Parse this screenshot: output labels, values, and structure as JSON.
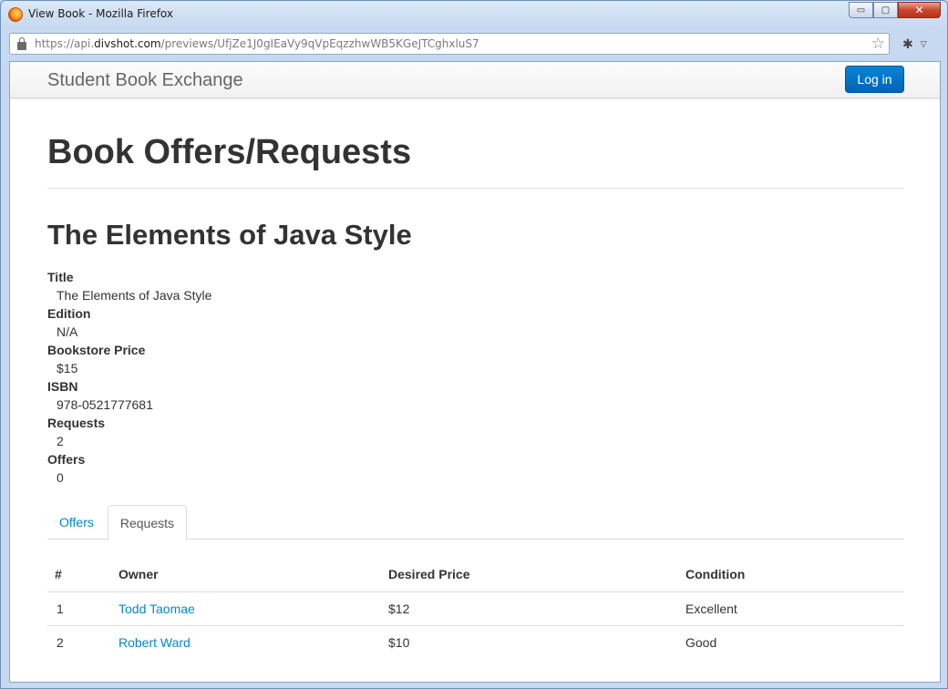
{
  "window": {
    "title": "View Book - Mozilla Firefox",
    "controls": {
      "minimize": "▭",
      "maximize": "▢",
      "close": "✕"
    }
  },
  "browser": {
    "url_prefix": "https://api.",
    "url_domain": "divshot.com",
    "url_path": "/previews/UfjZe1J0gIEaVy9qVpEqzzhwWB5KGeJTCghxluS7",
    "icons": [
      "lock-icon",
      "star-icon",
      "bug-icon",
      "dropdown-icon"
    ]
  },
  "navbar": {
    "brand": "Student Book Exchange",
    "login_label": "Log in"
  },
  "page": {
    "heading": "Book Offers/Requests",
    "book_title": "The Elements of Java Style"
  },
  "details": [
    {
      "label": "Title",
      "value": "The Elements of Java Style"
    },
    {
      "label": "Edition",
      "value": "N/A"
    },
    {
      "label": "Bookstore Price",
      "value": "$15"
    },
    {
      "label": "ISBN",
      "value": "978-0521777681"
    },
    {
      "label": "Requests",
      "value": "2"
    },
    {
      "label": "Offers",
      "value": "0"
    }
  ],
  "tabs": [
    {
      "label": "Offers",
      "active": false
    },
    {
      "label": "Requests",
      "active": true
    }
  ],
  "table": {
    "headers": [
      "#",
      "Owner",
      "Desired Price",
      "Condition"
    ],
    "rows": [
      {
        "num": "1",
        "owner": "Todd Taomae",
        "price": "$12",
        "condition": "Excellent"
      },
      {
        "num": "2",
        "owner": "Robert Ward",
        "price": "$10",
        "condition": "Good"
      }
    ]
  },
  "colors": {
    "accent": "#0088cc",
    "button": "#0070c9",
    "text": "#333333"
  }
}
